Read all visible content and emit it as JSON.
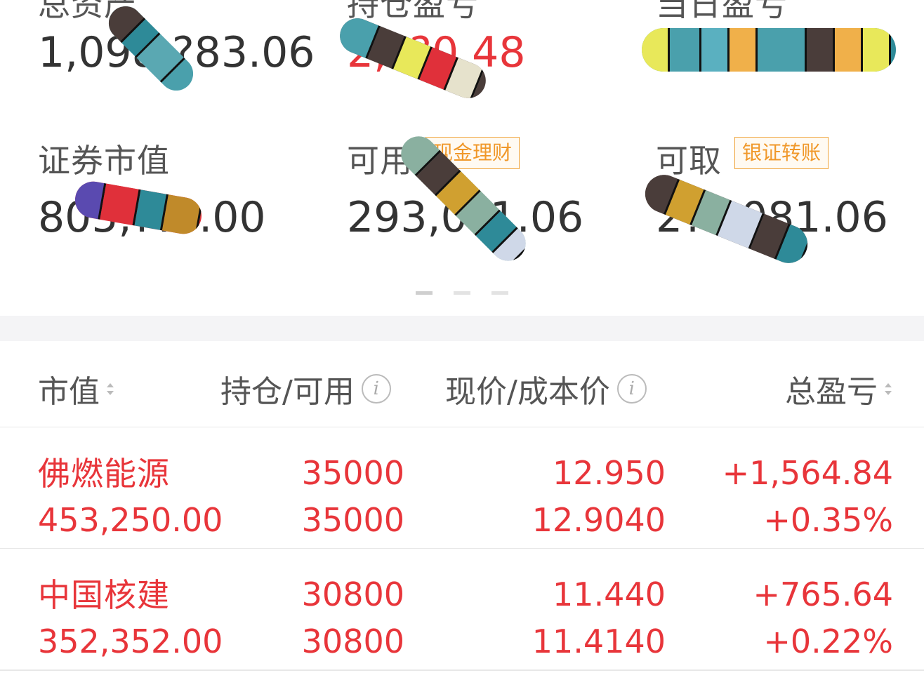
{
  "summary": {
    "row1": [
      {
        "label": "总资产",
        "value": "1,098,?83.06",
        "red": false
      },
      {
        "label": "持仓盈亏",
        "value": "2,??0.48",
        "red": true
      },
      {
        "label": "当日盈亏",
        "value": "",
        "red": false
      }
    ],
    "row2": [
      {
        "label": "证券市值",
        "value": "805,???.00"
      },
      {
        "label": "可用",
        "value": "293,0?1.06",
        "button": "现金理财"
      },
      {
        "label": "可取",
        "value": "2??,081.06",
        "button": "银证转账"
      }
    ],
    "pager": {
      "pages": 3,
      "active": 0
    }
  },
  "colors": {
    "red": "#e8353a",
    "orange": "#f0982a",
    "text": "#333333",
    "muted": "#555555"
  },
  "table": {
    "headers": {
      "market_value": "市值",
      "position_available": "持仓/可用",
      "price_cost": "现价/成本价",
      "total_pnl": "总盈亏"
    },
    "rows": [
      {
        "name": "佛燃能源",
        "market_value": "453,250.00",
        "position": "35000",
        "available": "35000",
        "price": "12.950",
        "cost": "12.9040",
        "pnl": "+1,564.84",
        "pnl_pct": "+0.35%"
      },
      {
        "name": "中国核建",
        "market_value": "352,352.00",
        "position": "30800",
        "available": "30800",
        "price": "11.440",
        "cost": "11.4140",
        "pnl": "+765.64",
        "pnl_pct": "+0.22%"
      }
    ]
  }
}
